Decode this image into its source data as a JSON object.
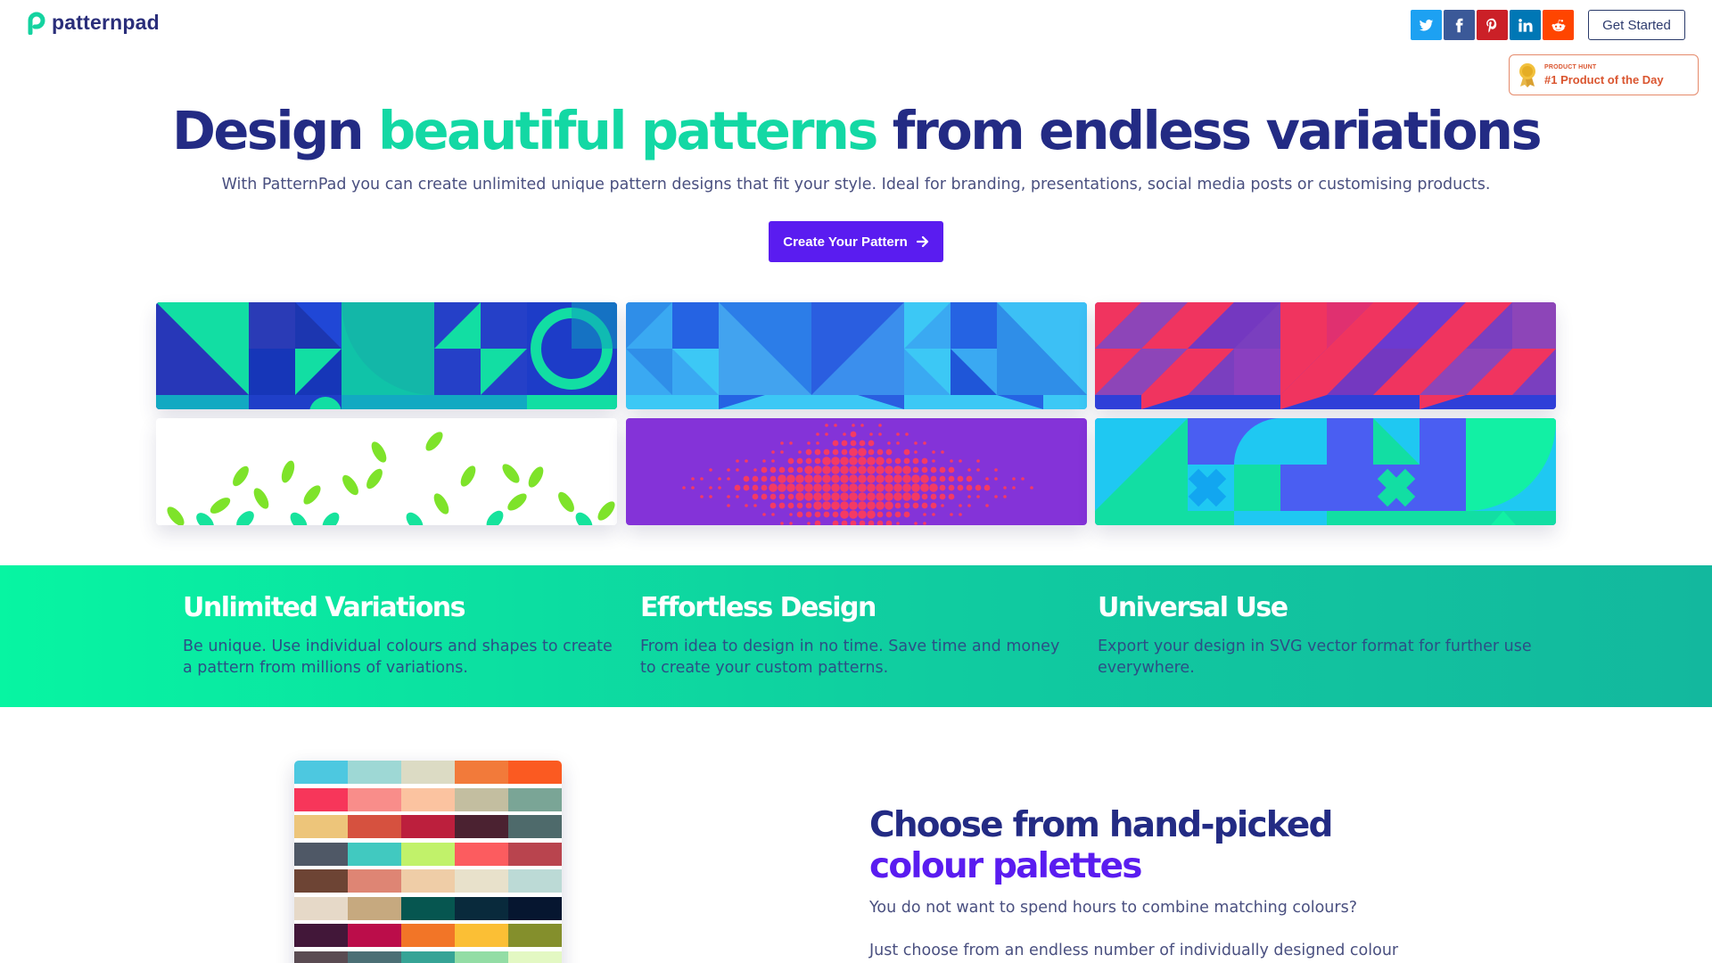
{
  "header": {
    "logo_text": "patternpad",
    "logo_icon": "patternpad-logo-icon",
    "share_buttons": [
      {
        "name": "twitter",
        "icon": "twitter-icon",
        "color": "#1da1f2"
      },
      {
        "name": "facebook",
        "icon": "facebook-icon",
        "color": "#3b5998"
      },
      {
        "name": "pinterest",
        "icon": "pinterest-icon",
        "color": "#cb2027"
      },
      {
        "name": "linkedin",
        "icon": "linkedin-icon",
        "color": "#0077b5"
      },
      {
        "name": "reddit",
        "icon": "reddit-icon",
        "color": "#ff4500"
      }
    ],
    "get_started_label": "Get Started",
    "product_hunt": {
      "small": "PRODUCT HUNT",
      "label": "#1 Product of the Day"
    }
  },
  "hero": {
    "title_part1": "Design ",
    "title_accent": "beautiful patterns",
    "title_part2": " from endless variations",
    "subtitle": "With PatternPad you can create unlimited unique pattern designs that fit your style. Ideal for branding, presentations, social media posts or customising products.",
    "cta_label": "Create Your Pattern",
    "accent_color": "#13d8a4",
    "primary_color": "#5a1cf0"
  },
  "patterns": [
    {
      "name": "geometric-teal-blue"
    },
    {
      "name": "triangles-blue"
    },
    {
      "name": "diagonal-pink-purple"
    },
    {
      "name": "leaves-green"
    },
    {
      "name": "dots-purple-red"
    },
    {
      "name": "shapes-blue-green"
    }
  ],
  "features": [
    {
      "title": "Unlimited Variations",
      "text": "Be unique. Use individual colours and shapes to create a pattern from millions of variations."
    },
    {
      "title": "Effortless Design",
      "text": "From idea to design in no time. Save time and money to create your custom patterns."
    },
    {
      "title": "Universal Use",
      "text": "Export your design in SVG vector format for further use everywhere."
    }
  ],
  "palettes": {
    "heading_part1": "Choose from hand-picked ",
    "heading_accent": "colour palettes",
    "text1": "You do not want to spend hours to combine matching colours?",
    "text2": "Just choose from an endless number of individually designed colour",
    "rows": [
      [
        "#4dc8e0",
        "#9ed8d5",
        "#dcdbc4",
        "#f27a3a",
        "#fb5a21"
      ],
      [
        "#f7365a",
        "#f98d8a",
        "#fbc3a0",
        "#c3bea0",
        "#7aa596"
      ],
      [
        "#edc57a",
        "#d6513f",
        "#bc1f3d",
        "#4b2231",
        "#4e6a6b"
      ],
      [
        "#4f5866",
        "#41c9c0",
        "#c1f26a",
        "#fc5c5f",
        "#b9444e"
      ],
      [
        "#6d4434",
        "#de8574",
        "#efcda7",
        "#e8e1cb",
        "#bcdad6"
      ],
      [
        "#e6d9c8",
        "#c6a97f",
        "#065650",
        "#092a3c",
        "#061630"
      ],
      [
        "#421739",
        "#bb0d4a",
        "#f27527",
        "#fbbf35",
        "#848f2c"
      ],
      [
        "#5a4b52",
        "#4b6f75",
        "#36a496",
        "#93dda5",
        "#e3f8c3"
      ]
    ]
  }
}
